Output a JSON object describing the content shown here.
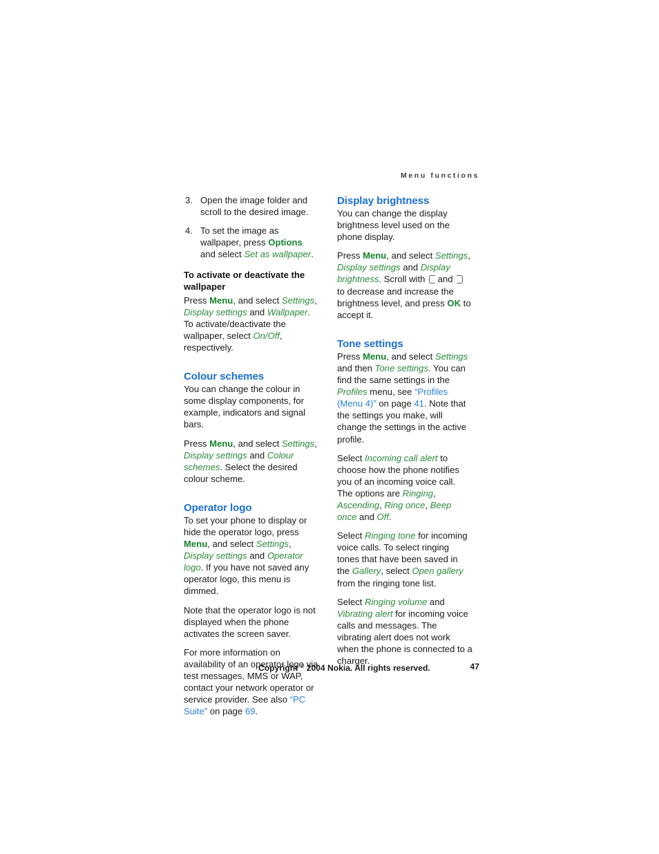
{
  "header": {
    "running_title": "Menu functions"
  },
  "left_column": {
    "steps": [
      {
        "num": "3.",
        "text": "Open the image folder and scroll to the desired image."
      },
      {
        "num": "4.",
        "text_before": "To set the image as wallpaper, press ",
        "bold": "Options",
        "text_mid": " and select ",
        "italic": "Set as wallpaper",
        "text_after": "."
      }
    ],
    "wallpaper_subhead": "To activate or deactivate the wallpaper",
    "wallpaper_para": {
      "t1": "Press ",
      "menu": "Menu",
      "t2": ", and select ",
      "i1": "Settings",
      "t3": ", ",
      "i2": "Display settings",
      "t4": " and ",
      "i3": "Wallpaper",
      "t5": ". To activate/deactivate the wallpaper, select ",
      "i4": "On",
      "t6": "/",
      "i5": "Off",
      "t7": ", respectively."
    },
    "colour_schemes": {
      "heading": "Colour schemes",
      "para1": "You can change the colour in some display components, for example, indicators and signal bars.",
      "para2": {
        "t1": "Press ",
        "menu": "Menu",
        "t2": ", and select ",
        "i1": "Settings",
        "t3": ", ",
        "i2": "Display settings",
        "t4": " and ",
        "i3": "Colour schemes",
        "t5": ". Select the desired colour scheme."
      }
    },
    "operator_logo": {
      "heading": "Operator logo",
      "para1": {
        "t1": "To set your phone to display or hide the operator logo, press ",
        "menu": "Menu",
        "t2": ", and select ",
        "i1": "Settings",
        "t3": ", ",
        "i2": "Display settings",
        "t4": " and ",
        "i3": "Operator logo",
        "t5": ". If you have not saved any operator logo, this menu is dimmed."
      },
      "para2": "Note that the operator logo is not displayed when the phone activates the screen saver.",
      "para3": {
        "t1": "For more information on availability of an operator logo via test messages, MMS or WAP, contact your network operator or service provider. See also ",
        "link1": "“PC Suite”",
        "t2": " on page ",
        "link2": "69",
        "t3": "."
      }
    }
  },
  "right_column": {
    "display_brightness": {
      "heading": "Display brightness",
      "para1": "You can change the display brightness level used on the phone display.",
      "para2": {
        "t1": "Press ",
        "menu": "Menu",
        "t2": ", and select ",
        "i1": "Settings",
        "t3": ", ",
        "i2": "Display settings",
        "t4": " and ",
        "i3": "Display brightness",
        "t5": ". Scroll with ",
        "key_left": "scroll-left-key",
        "t6": " and ",
        "key_right": "scroll-right-key",
        "t7": " to decrease and increase the brightness level, and press ",
        "ok": "OK",
        "t8": " to accept it."
      }
    },
    "tone_settings": {
      "heading": "Tone settings",
      "para1": {
        "t1": "Press ",
        "menu": "Menu",
        "t2": ", and select ",
        "i1": "Settings",
        "t3": " and then ",
        "i2": "Tone settings",
        "t4": ". You can find the same settings in the ",
        "i3": "Profiles",
        "t5": " menu, see ",
        "link1": "“Profiles (Menu 4)”",
        "t6": " on page ",
        "link2": "41",
        "t7": ". Note that the settings you make, will change the settings in the active profile."
      },
      "para2": {
        "t1": "Select ",
        "i1": "Incoming call alert",
        "t2": " to choose how the phone notifies you of an incoming voice call. The options are ",
        "i2": "Ringing",
        "t3": ", ",
        "i3": "Ascending",
        "t4": ", ",
        "i4": "Ring once",
        "t5": ", ",
        "i5": "Beep once",
        "t6": " and ",
        "i6": "Off",
        "t7": "."
      },
      "para3": {
        "t1": "Select ",
        "i1": "Ringing tone",
        "t2": " for incoming voice calls. To select ringing tones that have been saved in the ",
        "i2": "Gallery",
        "t3": ", select ",
        "i3": "Open gallery",
        "t4": " from the ringing tone list."
      },
      "para4": {
        "t1": "Select ",
        "i1": "Ringing volume",
        "t2": " and ",
        "i2": "Vibrating alert",
        "t3": " for incoming voice calls and messages. The vibrating alert does not work when the phone is connected to a charger."
      }
    }
  },
  "footer": {
    "copyright_before": "Copyright ",
    "copyright_symbol": "©",
    "copyright_after": " 2004 Nokia. All rights reserved.",
    "page_number": "47"
  },
  "colors": {
    "heading_blue": "#1d6fd0",
    "link_blue": "#2b7fd4",
    "emphasis_green": "#2c8a3c",
    "bold_green": "#17822e",
    "body_text": "#1a1a1a"
  }
}
